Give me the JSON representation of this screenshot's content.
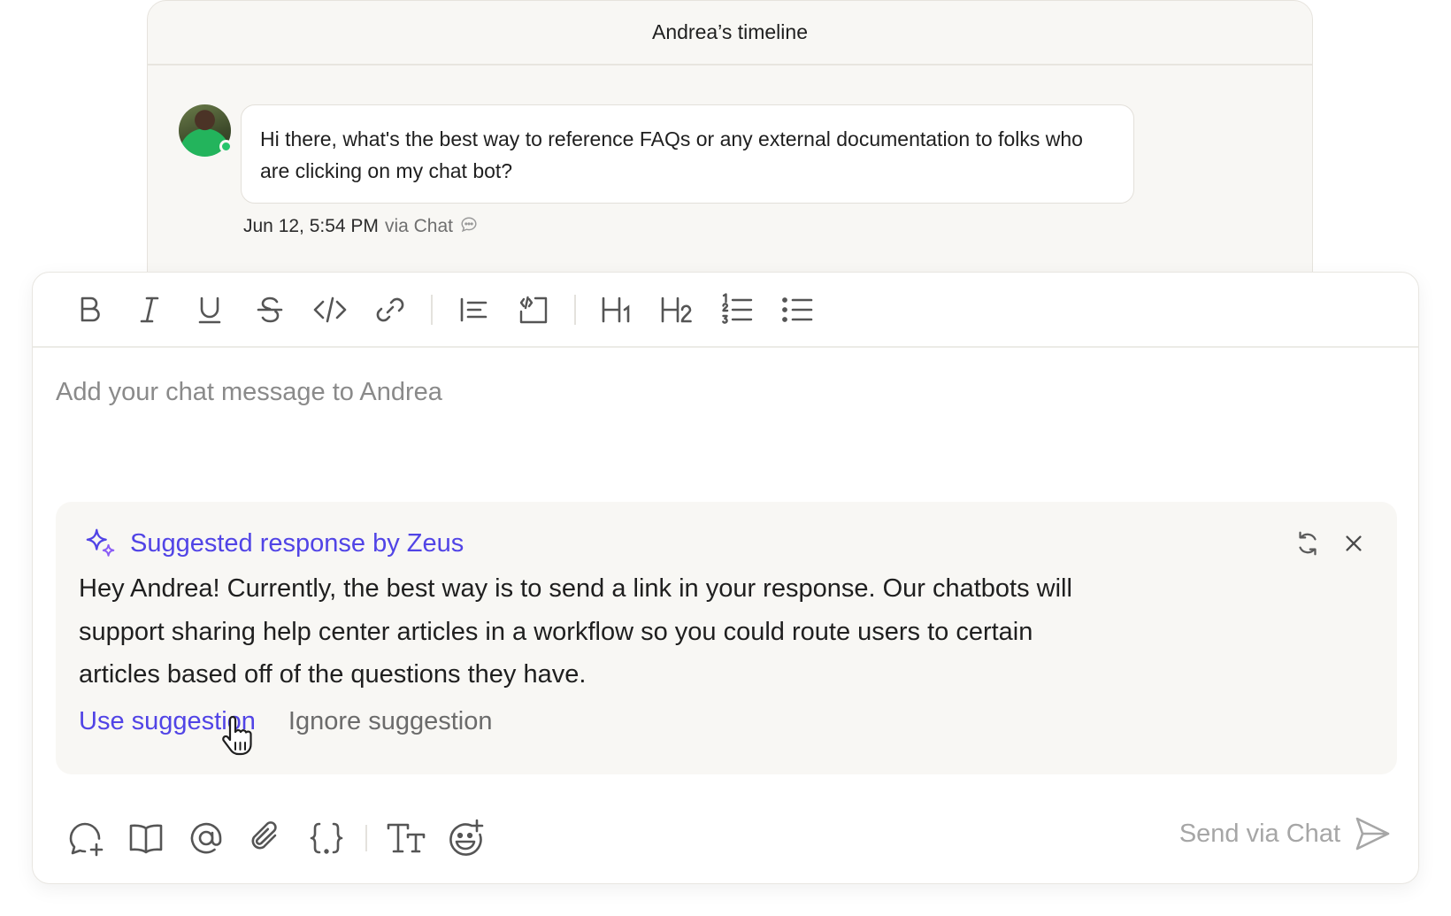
{
  "timeline": {
    "title": "Andrea’s timeline",
    "message": {
      "text": "Hi there, what's the best way to reference FAQs or any external documentation to folks who are clicking on my chat bot?",
      "timestamp": "Jun 12, 5:54 PM",
      "via": "via Chat",
      "status_color": "#26c46b"
    }
  },
  "toolbar": {
    "items": [
      "bold-icon",
      "italic-icon",
      "underline-icon",
      "strikethrough-icon",
      "code-icon",
      "link-icon",
      "blockquote-icon",
      "code-block-icon",
      "heading-1-icon",
      "heading-2-icon",
      "numbered-list-icon",
      "bulleted-list-icon"
    ]
  },
  "composer": {
    "placeholder": "Add your chat message to Andrea"
  },
  "suggestion": {
    "title": "Suggested response by Zeus",
    "body": "Hey Andrea! Currently, the best way is to send a link in your response. Our chatbots will support sharing help center articles in a workflow so you could route users to certain articles based off of the questions they have.",
    "use_label": "Use suggestion",
    "ignore_label": "Ignore suggestion",
    "accent_color": "#5144e6"
  },
  "bottombar": {
    "items": [
      "add-comment-icon",
      "knowledge-book-icon",
      "mention-icon",
      "attachment-icon",
      "placeholder-braces-icon",
      "text-format-icon",
      "emoji-add-icon"
    ],
    "send_label": "Send via Chat"
  }
}
